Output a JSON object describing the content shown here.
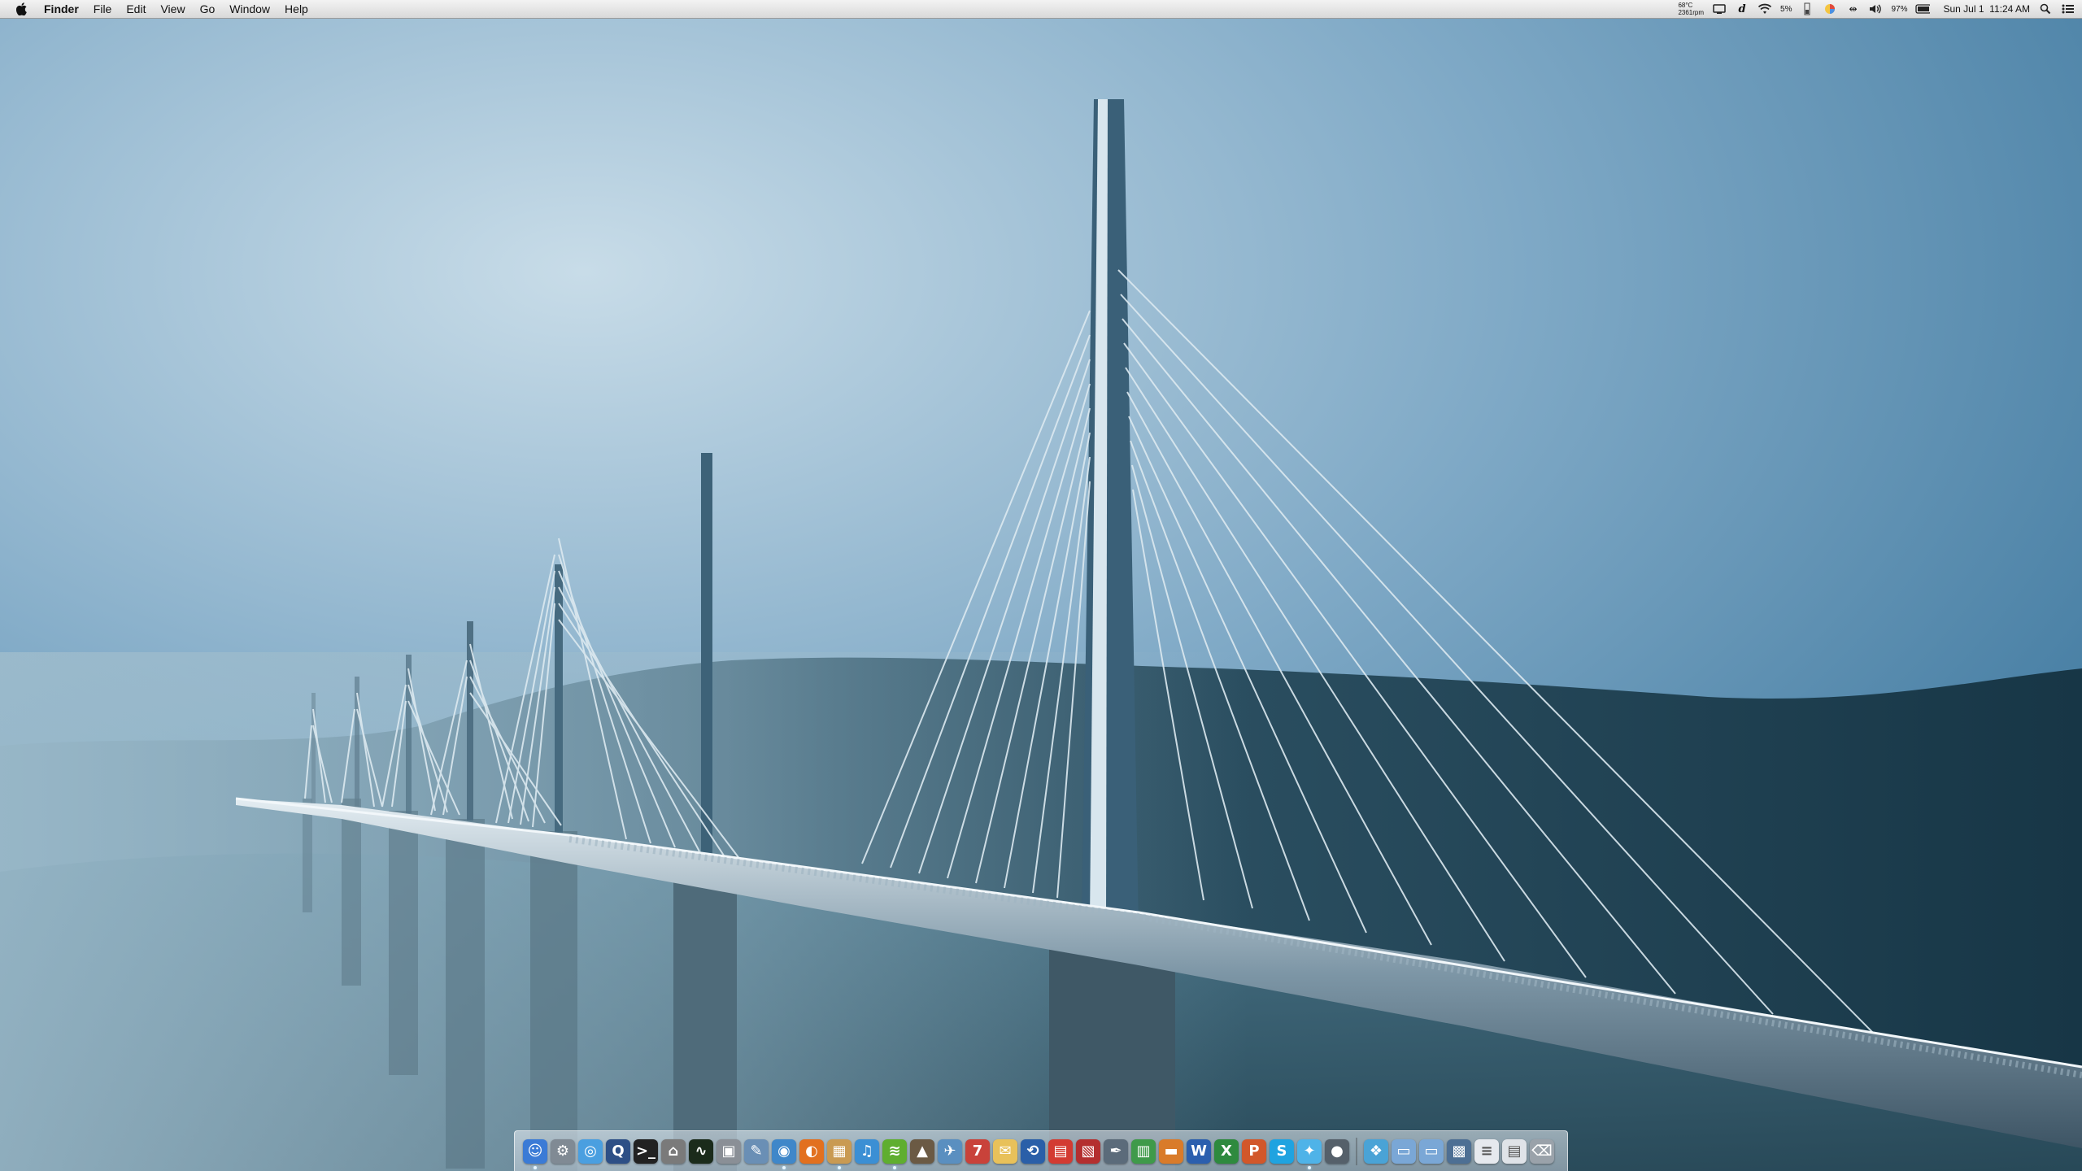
{
  "menubar": {
    "apple_icon": "apple-logo-icon",
    "app_name": "Finder",
    "menus": [
      "File",
      "Edit",
      "View",
      "Go",
      "Window",
      "Help"
    ],
    "weather": {
      "temp": "68°C",
      "info": "2361rpm"
    },
    "status_icons": [
      "display-icon",
      "dictionary-icon",
      "wifi-icon"
    ],
    "cpu": "5%",
    "battery_percent": "97%",
    "datetime": "Sun Jul 1  11:24 AM",
    "colors": {
      "bar_top": "#f3f3f3",
      "bar_bottom": "#d9d9d9"
    }
  },
  "wallpaper": {
    "subject": "cable-stayed viaduct over a misty valley",
    "colors": {
      "sky_light": "#b9d3e3",
      "sky_dark": "#2f6f98",
      "hills": "#1f4458"
    }
  },
  "dock": {
    "apps": [
      {
        "name": "finder-icon",
        "glyph": "☺",
        "color": "#3b7bd6",
        "running": true
      },
      {
        "name": "system-preferences-icon",
        "glyph": "⚙",
        "color": "#808a94",
        "running": false
      },
      {
        "name": "safari-icon",
        "glyph": "◎",
        "color": "#4a9fe0",
        "running": false
      },
      {
        "name": "quicktime-icon",
        "glyph": "Q",
        "color": "#2d4f86",
        "running": false
      },
      {
        "name": "terminal-icon",
        "glyph": ">_",
        "color": "#222222",
        "running": false
      },
      {
        "name": "script-editor-icon",
        "glyph": "⌂",
        "color": "#7a7a7a",
        "running": false
      },
      {
        "name": "activity-monitor-icon",
        "glyph": "∿",
        "color": "#1b2b1b",
        "running": false
      },
      {
        "name": "disk-utility-icon",
        "glyph": "▣",
        "color": "#8a8f96",
        "running": false
      },
      {
        "name": "preview-icon",
        "glyph": "✎",
        "color": "#6a8fb5",
        "running": false
      },
      {
        "name": "network-icon",
        "glyph": "◉",
        "color": "#3f87c9",
        "running": true
      },
      {
        "name": "firefox-icon",
        "glyph": "◐",
        "color": "#e2701f",
        "running": false
      },
      {
        "name": "archive-icon",
        "glyph": "▦",
        "color": "#c99a52",
        "running": true
      },
      {
        "name": "itunes-icon",
        "glyph": "♫",
        "color": "#3b8fd4",
        "running": false
      },
      {
        "name": "spotify-icon",
        "glyph": "≋",
        "color": "#5fae2f",
        "running": true
      },
      {
        "name": "iphoto-icon",
        "glyph": "▲",
        "color": "#6b5a44",
        "running": false
      },
      {
        "name": "mail-icon",
        "glyph": "✈",
        "color": "#5a8fc0",
        "running": false
      },
      {
        "name": "calendar-icon",
        "glyph": "7",
        "color": "#c9423a",
        "running": false
      },
      {
        "name": "notes-icon",
        "glyph": "✉",
        "color": "#e8c15a",
        "running": false
      },
      {
        "name": "sync-icon",
        "glyph": "⟲",
        "color": "#2a5fa8",
        "running": false
      },
      {
        "name": "ical-icon",
        "glyph": "▤",
        "color": "#d33b32",
        "running": false
      },
      {
        "name": "pdf-icon",
        "glyph": "▧",
        "color": "#b42f2f",
        "running": false
      },
      {
        "name": "pen-tool-icon",
        "glyph": "✒",
        "color": "#5b6b7a",
        "running": false
      },
      {
        "name": "numbers-icon",
        "glyph": "▥",
        "color": "#3f9a4a",
        "running": false
      },
      {
        "name": "keynote-icon",
        "glyph": "▬",
        "color": "#d97b2a",
        "running": false
      },
      {
        "name": "word-icon",
        "glyph": "W",
        "color": "#2b5fae",
        "running": false
      },
      {
        "name": "excel-icon",
        "glyph": "X",
        "color": "#2e8a3e",
        "running": false
      },
      {
        "name": "powerpoint-icon",
        "glyph": "P",
        "color": "#d2572a",
        "running": false
      },
      {
        "name": "skype-icon",
        "glyph": "S",
        "color": "#1fa3e0",
        "running": false
      },
      {
        "name": "twitter-icon",
        "glyph": "✦",
        "color": "#4fb3e8",
        "running": true
      },
      {
        "name": "microphone-icon",
        "glyph": "●",
        "color": "#55606a",
        "running": false
      }
    ],
    "stacks": [
      {
        "name": "bookmark-stack-icon",
        "glyph": "❖",
        "color": "#4aa3d6"
      },
      {
        "name": "documents-folder-icon",
        "glyph": "▭",
        "color": "#7aa7d6"
      },
      {
        "name": "downloads-folder-icon",
        "glyph": "▭",
        "color": "#7aa7d6"
      },
      {
        "name": "screen-stack-icon",
        "glyph": "▩",
        "color": "#4d6f94"
      },
      {
        "name": "text-document-icon",
        "glyph": "≡",
        "color": "#e6e9ee"
      },
      {
        "name": "document-stack-icon",
        "glyph": "▤",
        "color": "#dfe3e8"
      },
      {
        "name": "trash-icon",
        "glyph": "⌫",
        "color": "#9aa2aa"
      }
    ]
  }
}
